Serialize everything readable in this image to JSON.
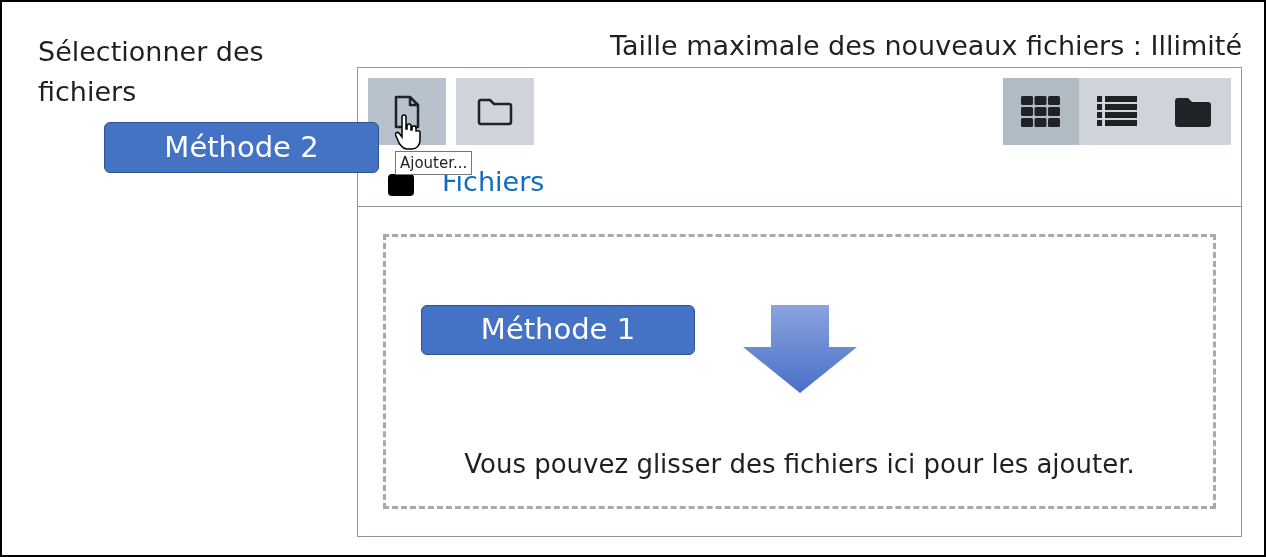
{
  "field_label": "Sélectionner des fichiers",
  "max_size": "Taille maximale des nouveaux fichiers : Illimité",
  "toolbar": [
    {
      "kind": "file",
      "selected": true
    },
    {
      "kind": "folder",
      "selected": false
    }
  ],
  "view_buttons": [
    {
      "kind": "grid",
      "selected": true
    },
    {
      "kind": "list",
      "selected": false
    },
    {
      "kind": "tree",
      "selected": false
    }
  ],
  "tooltip": "Ajouter...",
  "breadcrumb": "Fichiers",
  "dropzone": {
    "message": "Vous pouvez glisser des fichiers ici pour les ajouter."
  },
  "callouts": [
    {
      "text": "Méthode 2"
    },
    {
      "text": "Méthode 1"
    }
  ]
}
